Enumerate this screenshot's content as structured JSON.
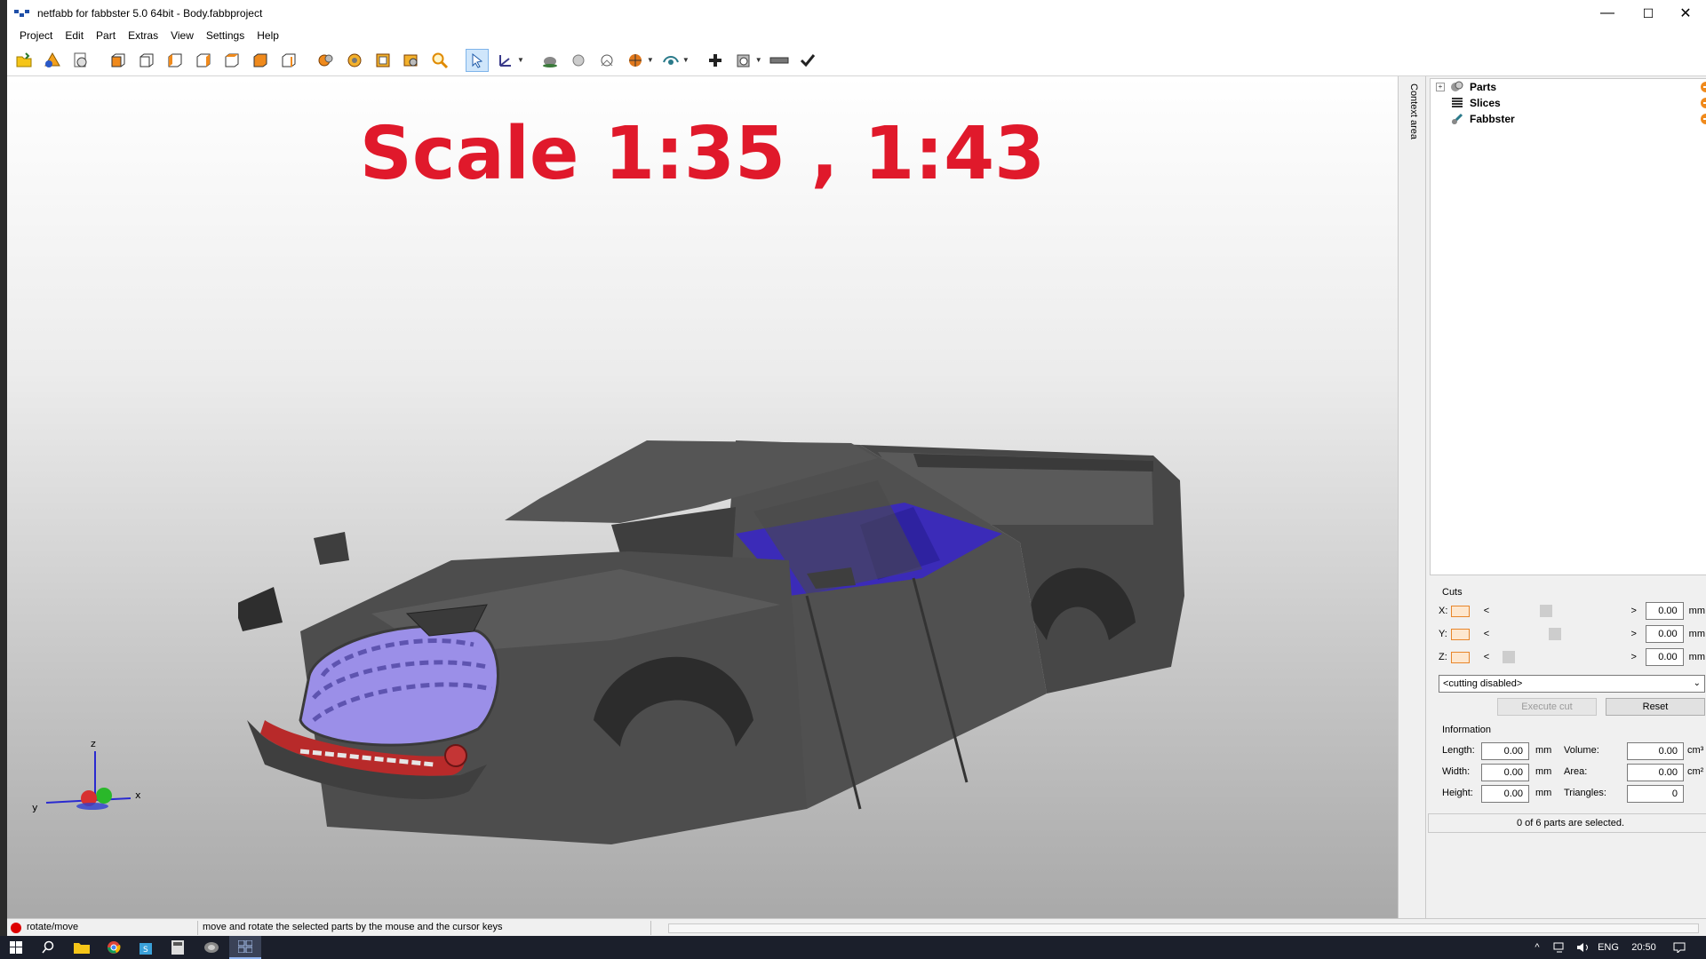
{
  "window": {
    "title": "netfabb for fabbster 5.0 64bit - Body.fabbproject",
    "controls": {
      "minimize": "—",
      "maximize": "☐",
      "close": "✕"
    }
  },
  "menu": [
    "Project",
    "Edit",
    "Part",
    "Extras",
    "View",
    "Settings",
    "Help"
  ],
  "toolbar": {
    "groups": [
      [
        "open-project-icon",
        "add-part-icon",
        "import-icon"
      ],
      [
        "view-front-icon",
        "view-back-icon",
        "view-left-icon",
        "view-right-icon",
        "view-top-icon",
        "view-bottom-icon",
        "view-perspective-icon"
      ],
      [
        "zoom-part-icon",
        "zoom-all-icon",
        "zoom-selection-icon",
        "zoom-window-icon",
        "zoom-icon"
      ],
      [
        "select-pointer-icon",
        "rotate-move-icon"
      ],
      [
        "shading-icon",
        "transparency-icon",
        "coordinate-system-icon",
        "color-mode-icon",
        "view-options-icon"
      ],
      [
        "add-icon",
        "repair-icon",
        "measure-icon",
        "apply-icon"
      ]
    ],
    "active_tool": "select-pointer-icon"
  },
  "viewport": {
    "overlay_text": "Scale 1:35 , 1:43",
    "axis_labels": {
      "x": "x",
      "y": "y",
      "z": "z"
    }
  },
  "side_tab": {
    "label": "Context area"
  },
  "tree": {
    "items": [
      {
        "label": "Parts",
        "icon": "parts-icon",
        "expandable": true
      },
      {
        "label": "Slices",
        "icon": "slices-icon",
        "expandable": false
      },
      {
        "label": "Fabbster",
        "icon": "printer-icon",
        "expandable": false
      }
    ]
  },
  "cuts": {
    "label": "Cuts",
    "rows": [
      {
        "axis": "X:",
        "value": "0.00",
        "unit": "mm",
        "slider_pos": 0.38
      },
      {
        "axis": "Y:",
        "value": "0.00",
        "unit": "mm",
        "slider_pos": 0.45
      },
      {
        "axis": "Z:",
        "value": "0.00",
        "unit": "mm",
        "slider_pos": 0.05
      }
    ],
    "mode_select": "<cutting disabled>",
    "execute_label": "Execute cut",
    "reset_label": "Reset"
  },
  "information": {
    "label": "Information",
    "length_label": "Length:",
    "length_value": "0.00",
    "length_unit": "mm",
    "width_label": "Width:",
    "width_value": "0.00",
    "width_unit": "mm",
    "height_label": "Height:",
    "height_value": "0.00",
    "height_unit": "mm",
    "volume_label": "Volume:",
    "volume_value": "0.00",
    "volume_unit": "cm³",
    "area_label": "Area:",
    "area_value": "0.00",
    "area_unit": "cm²",
    "triangles_label": "Triangles:",
    "triangles_value": "0"
  },
  "selection_info": "0 of 6 parts are selected.",
  "statusbar": {
    "mode": "rotate/move",
    "hint": "move and rotate the selected parts by the mouse and the cursor keys"
  },
  "taskbar": {
    "apps": [
      "start-icon",
      "search-icon",
      "file-explorer-icon",
      "chrome-icon",
      "store-icon",
      "calculator-icon",
      "netfabb-icon",
      "task-view-icon"
    ],
    "language": "ENG",
    "time": "20:50"
  },
  "colors": {
    "overlay_text": "#e0192b",
    "truck_body": "#4a4a4a",
    "interior": "#3b2bb8",
    "grille": "#9b8fe8",
    "bumper": "#b82a2a"
  }
}
